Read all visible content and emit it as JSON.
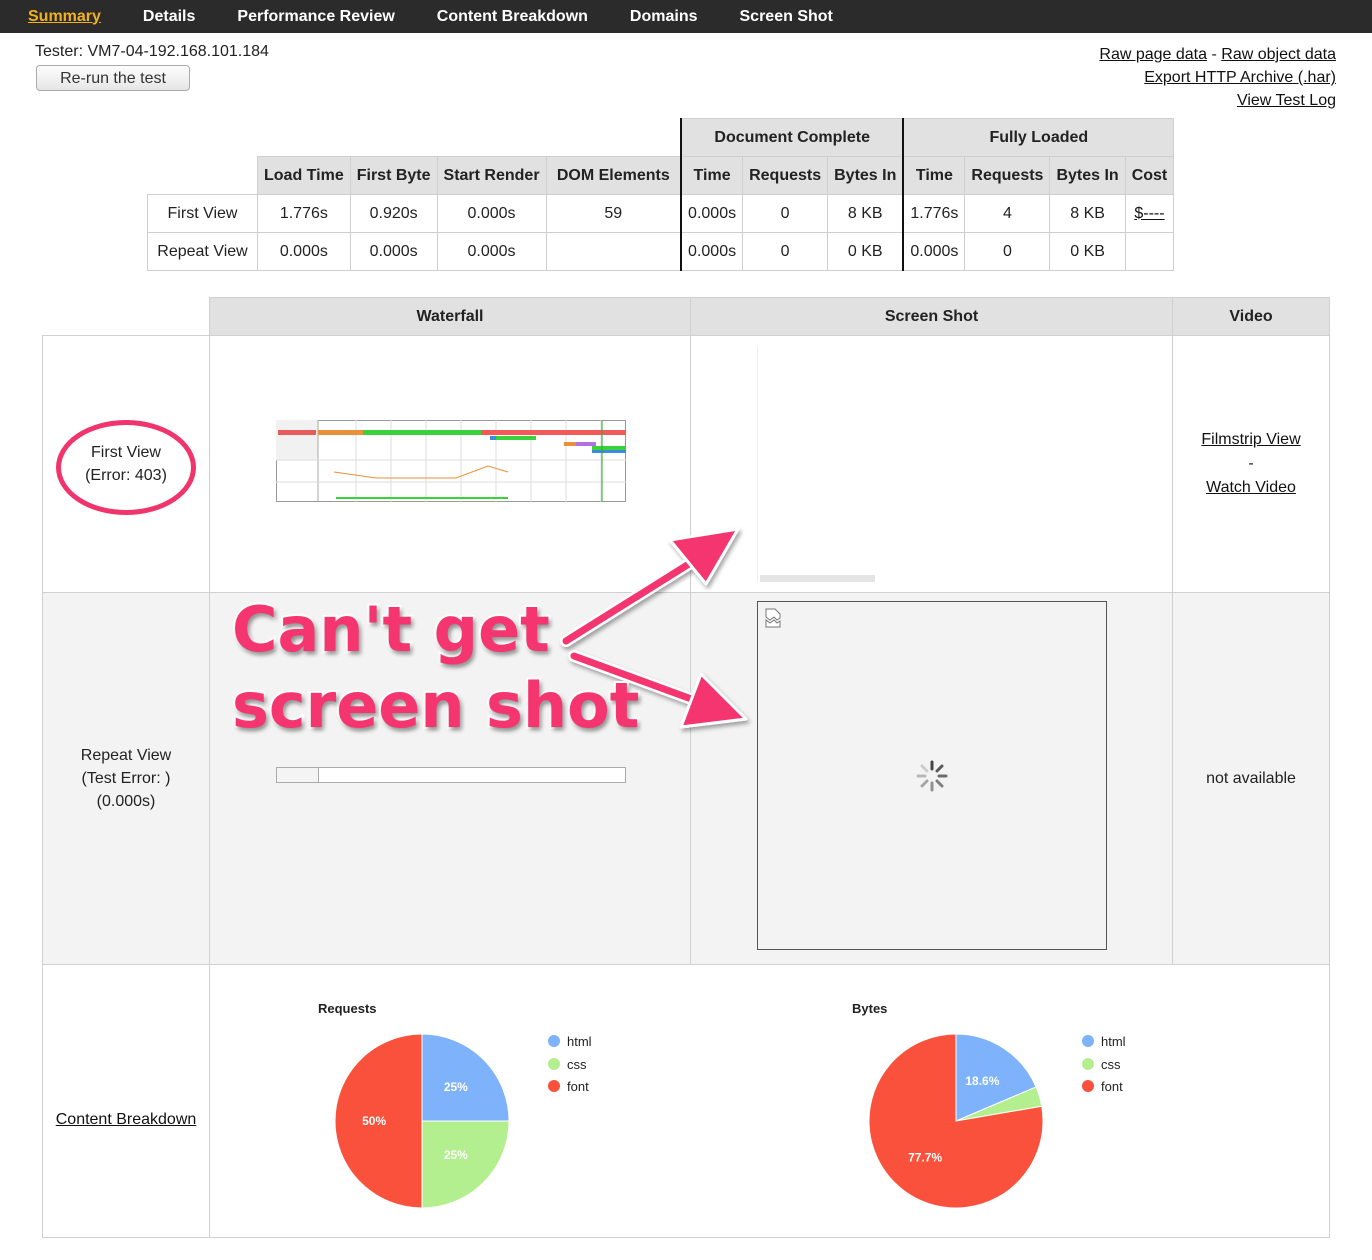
{
  "nav": {
    "items": [
      "Summary",
      "Details",
      "Performance Review",
      "Content Breakdown",
      "Domains",
      "Screen Shot"
    ],
    "active": "Summary"
  },
  "header": {
    "tester": "Tester: VM7-04-192.168.101.184",
    "rerun_label": "Re-run the test",
    "links": {
      "raw_page": "Raw page data",
      "separator": "-",
      "raw_object": "Raw object data",
      "export_har": "Export HTTP Archive (.har)",
      "view_log": "View Test Log"
    }
  },
  "summary": {
    "group_doc": "Document Complete",
    "group_full": "Fully Loaded",
    "columns": [
      "Load Time",
      "First Byte",
      "Start Render",
      "DOM Elements",
      "Time",
      "Requests",
      "Bytes In",
      "Time",
      "Requests",
      "Bytes In",
      "Cost"
    ],
    "rows": [
      {
        "label": "First View",
        "cells": [
          "1.776s",
          "0.920s",
          "0.000s",
          "59",
          "0.000s",
          "0",
          "8 KB",
          "1.776s",
          "4",
          "8 KB",
          "$----"
        ]
      },
      {
        "label": "Repeat View",
        "cells": [
          "0.000s",
          "0.000s",
          "0.000s",
          "",
          "0.000s",
          "0",
          "0 KB",
          "0.000s",
          "0",
          "0 KB",
          ""
        ]
      }
    ]
  },
  "grid": {
    "headers": {
      "waterfall": "Waterfall",
      "screenshot": "Screen Shot",
      "video": "Video"
    },
    "first_view": {
      "line1": "First View",
      "line2": "(Error: 403)"
    },
    "repeat_view": {
      "line1": "Repeat View",
      "line2": "(Test Error: )",
      "line3": "(0.000s)"
    },
    "video_links": {
      "filmstrip": "Filmstrip View",
      "dash": "-",
      "watch": "Watch Video"
    },
    "not_available": "not available",
    "content_breakdown": "Content Breakdown"
  },
  "annotation": {
    "line1": "Can't get",
    "line2": "screen shot",
    "color": "#f5356f"
  },
  "chart_data": [
    {
      "type": "pie",
      "title": "Requests",
      "categories": [
        "html",
        "css",
        "font"
      ],
      "values": [
        25,
        25,
        50
      ],
      "labels": [
        "25%",
        "25%",
        "50%"
      ],
      "colors": [
        "#7eb2fa",
        "#b4ef8f",
        "#fa513c"
      ]
    },
    {
      "type": "pie",
      "title": "Bytes",
      "categories": [
        "html",
        "css",
        "font"
      ],
      "values": [
        18.6,
        3.7,
        77.7
      ],
      "labels": [
        "18.6%",
        "",
        "77.7%"
      ],
      "colors": [
        "#7eb2fa",
        "#b4ef8f",
        "#fa513c"
      ]
    }
  ]
}
